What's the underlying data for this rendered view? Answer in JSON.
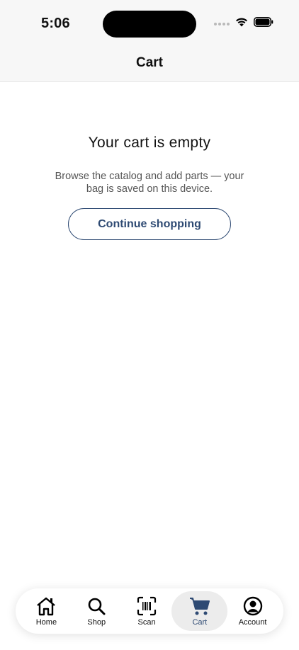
{
  "status_bar": {
    "time": "5:06"
  },
  "header": {
    "title": "Cart"
  },
  "empty_state": {
    "title": "Your cart is empty",
    "description": "Browse the catalog and add parts — your bag is saved on this device.",
    "button_label": "Continue shopping"
  },
  "tab_bar": {
    "items": [
      {
        "label": "Home",
        "icon": "home-icon"
      },
      {
        "label": "Shop",
        "icon": "search-icon"
      },
      {
        "label": "Scan",
        "icon": "barcode-scan-icon"
      },
      {
        "label": "Cart",
        "icon": "cart-icon",
        "active": true
      },
      {
        "label": "Account",
        "icon": "account-icon"
      }
    ]
  },
  "colors": {
    "accent": "#2e4a73",
    "active_tab_bg": "#ececec",
    "header_bg": "#f7f7f7"
  }
}
